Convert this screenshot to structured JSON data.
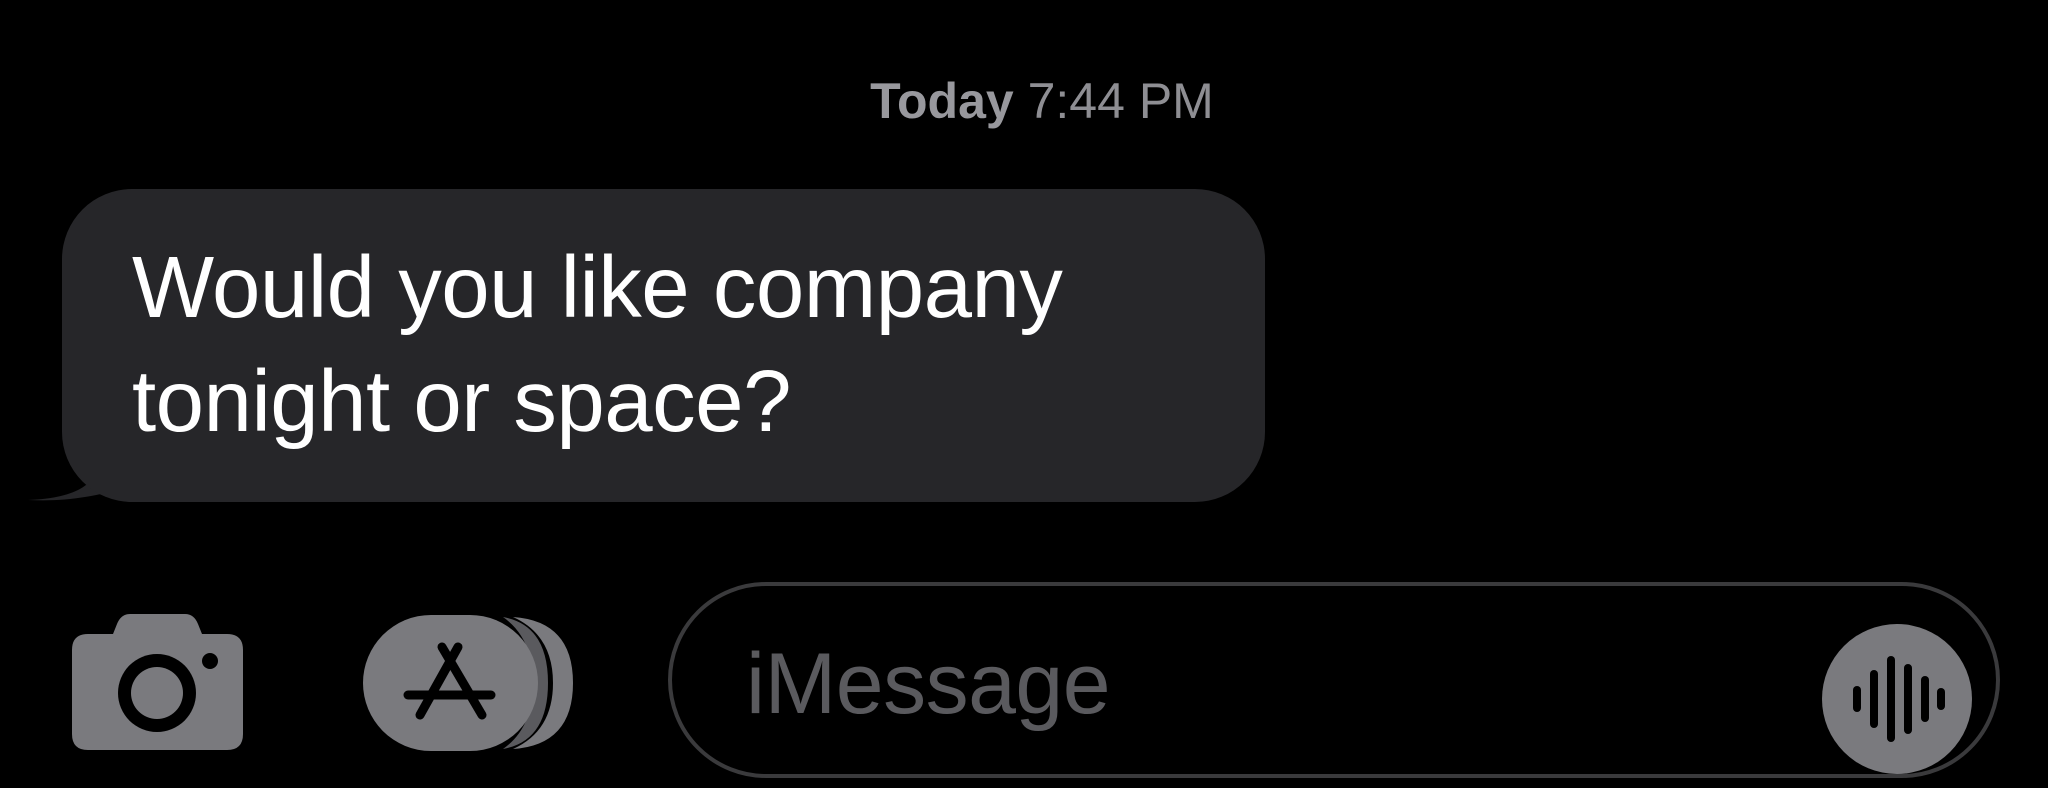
{
  "conversation": {
    "timestamp": {
      "day": "Today",
      "time": "7:44 PM"
    },
    "messages": [
      {
        "direction": "incoming",
        "text": "Would you like company\ntonight or space?"
      }
    ]
  },
  "input_bar": {
    "camera_icon": "camera-icon",
    "apps_icon": "app-store-icon",
    "placeholder": "iMessage",
    "audio_icon": "waveform-icon"
  },
  "colors": {
    "background": "#000000",
    "incoming_bubble": "#262629",
    "message_text": "#ffffff",
    "timestamp_text": "#8e8e93",
    "icon_gray": "#7a7a7e",
    "field_border": "#3a3a3c",
    "placeholder_text": "#5a5a5e"
  }
}
